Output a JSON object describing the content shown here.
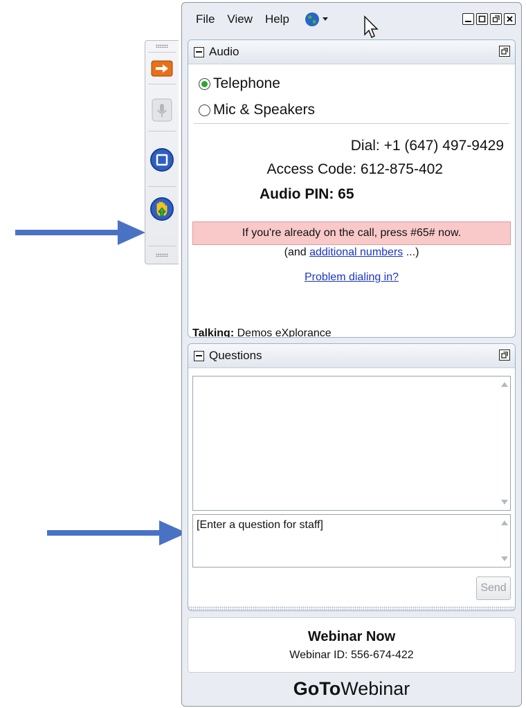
{
  "menu": {
    "file": "File",
    "view": "View",
    "help": "Help"
  },
  "audio": {
    "title": "Audio",
    "option_telephone": "Telephone",
    "option_mic": "Mic & Speakers",
    "selected": "Telephone",
    "dial_label": "Dial:",
    "dial_number": "+1 (647) 497-9429",
    "access_label": "Access Code:",
    "access_code": "612-875-402",
    "pin_label": "Audio PIN:",
    "pin": "65",
    "notice": "If you're already on the call, press #65# now.",
    "additional_prefix": "(and ",
    "additional_link": "additional numbers",
    "additional_suffix": " ...)",
    "problem_link": "Problem dialing in?",
    "talking_label": "Talking:",
    "talking_name": "Demos eXplorance"
  },
  "questions": {
    "title": "Questions",
    "input_placeholder": "[Enter a question for staff]",
    "send_label": "Send"
  },
  "webinar": {
    "title": "Webinar Now",
    "id_label": "Webinar ID:",
    "id": "556-674-422"
  },
  "brand": {
    "bold": "GoTo",
    "normal": "Webinar"
  },
  "colors": {
    "notice_bg": "#f9c9c9",
    "link": "#1a35c6",
    "arrow": "#4a72c4",
    "radio_on": "#2ba52b"
  }
}
